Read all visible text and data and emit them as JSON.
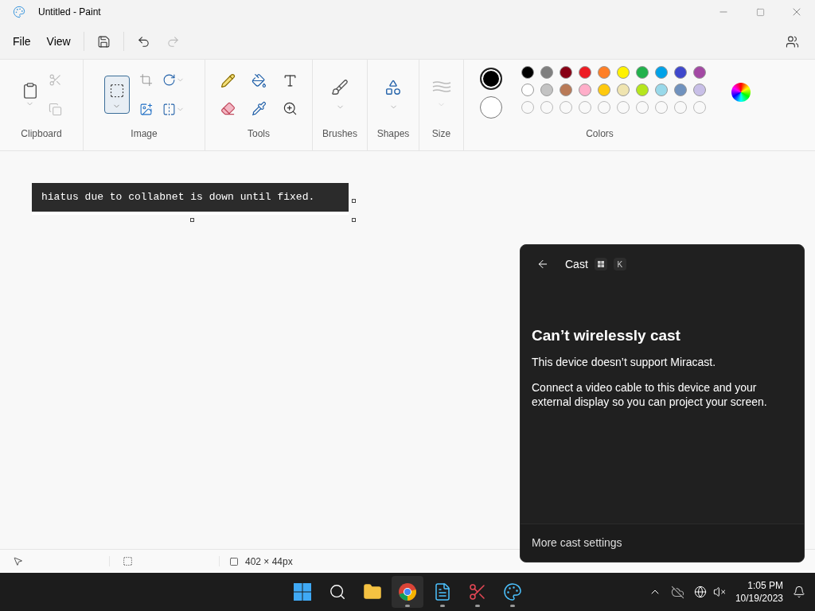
{
  "window": {
    "title": "Untitled - Paint"
  },
  "menu": [
    "File",
    "View"
  ],
  "ribbon": {
    "groups": [
      "Clipboard",
      "Image",
      "Tools",
      "Brushes",
      "Shapes",
      "Size",
      "Colors"
    ]
  },
  "colors": {
    "current": [
      {
        "color": "#000000",
        "selected": true
      },
      {
        "color": "#ffffff",
        "selected": false
      }
    ],
    "palette": [
      [
        {
          "color": "#000000"
        },
        {
          "color": "#7f7f7f"
        },
        {
          "color": "#880015"
        },
        {
          "color": "#ed1c24"
        },
        {
          "color": "#ff7f27"
        },
        {
          "color": "#fff200"
        },
        {
          "color": "#22b14c"
        },
        {
          "color": "#00a2e8"
        },
        {
          "color": "#3f48cc"
        },
        {
          "color": "#a349a4"
        }
      ],
      [
        {
          "color": "#ffffff"
        },
        {
          "color": "#c3c3c3"
        },
        {
          "color": "#b97a57"
        },
        {
          "color": "#ffaec9"
        },
        {
          "color": "#ffc90e"
        },
        {
          "color": "#efe4b0"
        },
        {
          "color": "#b5e61d"
        },
        {
          "color": "#99d9ea"
        },
        {
          "color": "#7092be"
        },
        {
          "color": "#c8bfe7"
        }
      ]
    ]
  },
  "canvas": {
    "text": "hiatus due to collabnet is down until fixed."
  },
  "status_bar": {
    "size": "402 × 44px"
  },
  "cast_panel": {
    "title": "Cast",
    "shortcut_key": "K",
    "heading": "Can’t wirelessly cast",
    "message": "This device doesn’t support Miracast.",
    "detail": "Connect a video cable to this device and your external display so you can project your screen.",
    "footer_link": "More cast settings"
  },
  "taskbar": {
    "apps": [
      {
        "kind": "start",
        "running": false,
        "selected": false
      },
      {
        "kind": "search",
        "running": false,
        "selected": false
      },
      {
        "kind": "explorer",
        "running": false,
        "selected": false
      },
      {
        "kind": "chrome",
        "running": true,
        "selected": true
      },
      {
        "kind": "notepad",
        "running": true,
        "selected": false
      },
      {
        "kind": "snip",
        "running": true,
        "selected": false
      },
      {
        "kind": "paint",
        "running": true,
        "selected": false
      }
    ],
    "time": "1:05 PM",
    "date": "10/19/2023"
  }
}
